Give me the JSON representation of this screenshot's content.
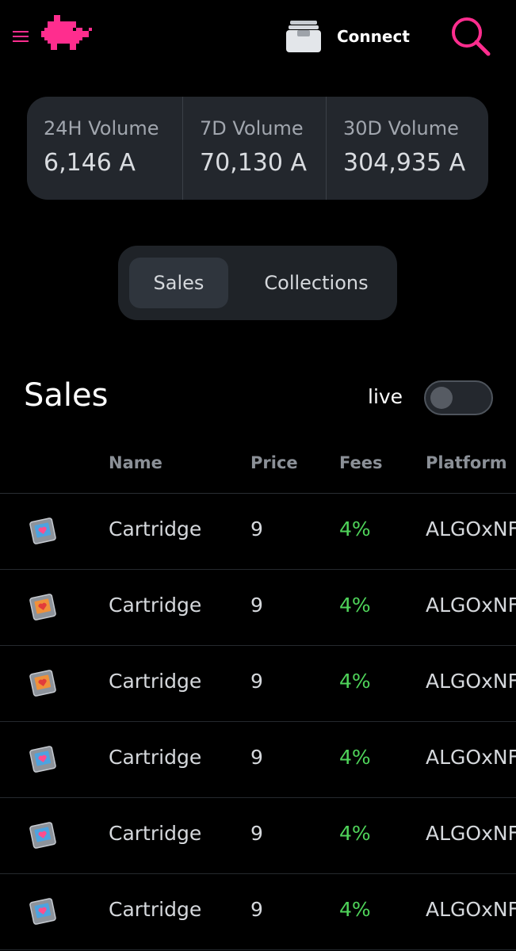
{
  "header": {
    "menu_icon": "hamburger-icon",
    "logo_icon": "pixel-pig-logo",
    "wallet_icon": "wallet-icon",
    "connect_label": "Connect",
    "search_icon": "search-icon",
    "accent_color": "#ff2d8e"
  },
  "stats": [
    {
      "label": "24H Volume",
      "value": "6,146 A"
    },
    {
      "label": "7D Volume",
      "value": "70,130 A"
    },
    {
      "label": "30D Volume",
      "value": "304,935 A"
    }
  ],
  "tabs": [
    {
      "label": "Sales",
      "active": true
    },
    {
      "label": "Collections",
      "active": false
    }
  ],
  "sales": {
    "title": "Sales",
    "live_label": "live",
    "live_on": false,
    "columns": [
      "",
      "Name",
      "Price",
      "Fees",
      "Platform"
    ],
    "rows": [
      {
        "thumb": "cartridge-blue",
        "name": "Cartridge",
        "price": "9",
        "fees": "4%",
        "platform": "ALGOxNFT"
      },
      {
        "thumb": "cartridge-orange",
        "name": "Cartridge",
        "price": "9",
        "fees": "4%",
        "platform": "ALGOxNFT"
      },
      {
        "thumb": "cartridge-orange",
        "name": "Cartridge",
        "price": "9",
        "fees": "4%",
        "platform": "ALGOxNFT"
      },
      {
        "thumb": "cartridge-blue",
        "name": "Cartridge",
        "price": "9",
        "fees": "4%",
        "platform": "ALGOxNFT"
      },
      {
        "thumb": "cartridge-blue",
        "name": "Cartridge",
        "price": "9",
        "fees": "4%",
        "platform": "ALGOxNFT"
      },
      {
        "thumb": "cartridge-blue",
        "name": "Cartridge",
        "price": "9",
        "fees": "4%",
        "platform": "ALGOxNFT"
      }
    ],
    "fees_color": "#4fd45a"
  }
}
